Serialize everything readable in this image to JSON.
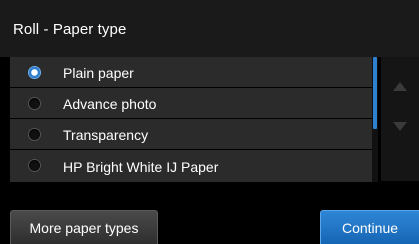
{
  "header": {
    "title": "Roll - Paper type"
  },
  "paper_list": {
    "items": [
      {
        "label": "Plain paper",
        "selected": true
      },
      {
        "label": "Advance photo",
        "selected": false
      },
      {
        "label": "Transparency",
        "selected": false
      },
      {
        "label": "HP Bright White IJ Paper",
        "selected": false
      }
    ]
  },
  "scroll": {
    "up_icon": "triangle-up-icon",
    "down_icon": "triangle-down-icon"
  },
  "footer": {
    "more_label": "More paper types",
    "continue_label": "Continue"
  },
  "colors": {
    "accent": "#2f7fd1",
    "list_bg": "#2b2b2b",
    "title_bg": "#1a1a1a"
  }
}
